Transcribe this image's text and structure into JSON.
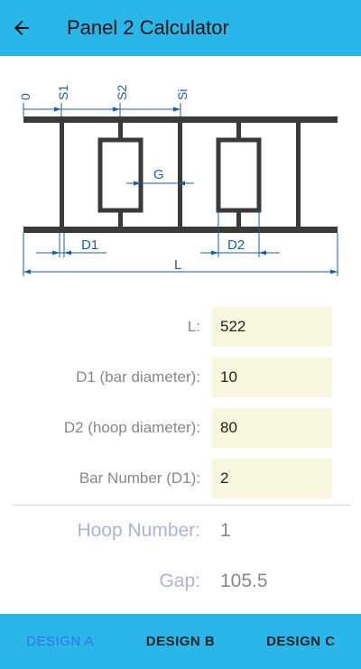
{
  "appbar": {
    "title": "Panel 2 Calculator"
  },
  "diagram": {
    "labels": {
      "origin": "0",
      "s1": "S1",
      "s2": "S2",
      "si": "Si",
      "gap": "G",
      "d1": "D1",
      "d2": "D2",
      "length": "L"
    }
  },
  "form": {
    "fields": [
      {
        "label": "L:",
        "value": "522"
      },
      {
        "label": "D1 (bar diameter):",
        "value": "10"
      },
      {
        "label": "D2 (hoop diameter):",
        "value": "80"
      },
      {
        "label": "Bar Number (D1):",
        "value": "2"
      }
    ]
  },
  "results": {
    "hoop_label": "Hoop Number:",
    "hoop_value": "1",
    "gap_label": "Gap:",
    "gap_value": "105.5"
  },
  "nav": {
    "tabs": [
      "DESIGN A",
      "DESIGN B",
      "DESIGN C"
    ],
    "active_index": 0
  },
  "colors": {
    "bar": "#29B6E9",
    "field": "#F8F6DC",
    "active_tab": "#3B6FE8",
    "dimension": "#1A5EA8"
  }
}
